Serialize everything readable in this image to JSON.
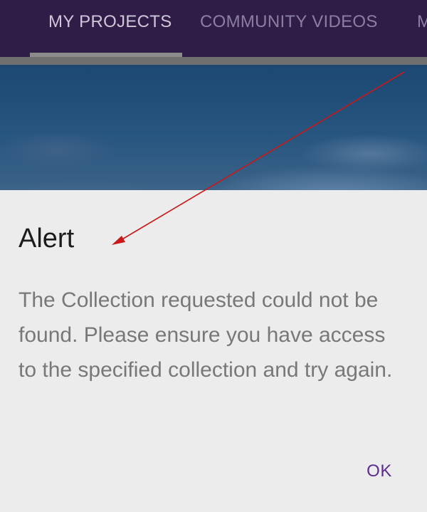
{
  "tabs": [
    {
      "label": "MY PROJECTS",
      "active": true
    },
    {
      "label": "COMMUNITY VIDEOS",
      "active": false
    },
    {
      "label": "M",
      "active": false
    }
  ],
  "dialog": {
    "title": "Alert",
    "message": "The Collection requested could not be found. Please ensure you have access to the specified collection and try again.",
    "ok_label": "OK"
  },
  "colors": {
    "tabbar_background": "#2f1d48",
    "dialog_background": "#ececec",
    "ok_button": "#5b2d8e",
    "annotation_arrow": "#c81818"
  },
  "icons": [
    "arrow-annotation-icon"
  ]
}
